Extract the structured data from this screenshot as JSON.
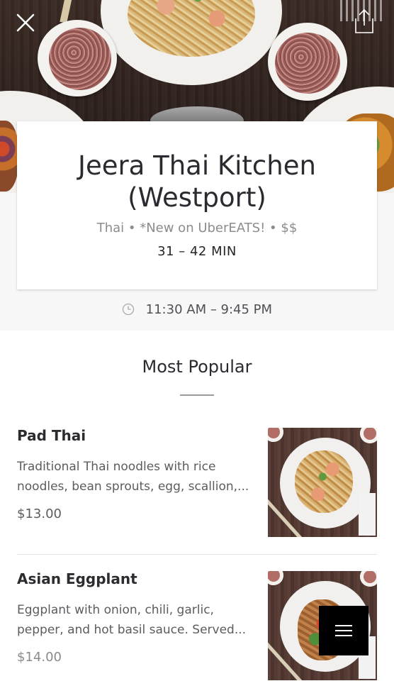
{
  "hero": {
    "close_icon": "close-icon",
    "share_icon": "share-icon"
  },
  "restaurant": {
    "name_line1": "Jeera Thai Kitchen",
    "name_line2": "(Westport)",
    "meta": "Thai • *New on UberEATS! • $$",
    "eta": "31 – 42 MIN",
    "hours": "11:30 AM – 9:45 PM",
    "hours_icon": "clock-icon"
  },
  "menu": {
    "section_title": "Most Popular",
    "items": [
      {
        "name": "Pad Thai",
        "desc_line1": "Traditional Thai noodles with rice",
        "desc_line2": "noodles, bean sprouts, egg, scallion,...",
        "price": "$13.00"
      },
      {
        "name": "Asian Eggplant",
        "desc_line1": "Eggplant with onion, chili, garlic,",
        "desc_line2": "pepper, and hot basil sauce. Served...",
        "price": "$14.00"
      }
    ]
  },
  "fab": {
    "icon": "hamburger-menu-icon"
  },
  "colors": {
    "card_bg": "#ffffff",
    "band_bg": "#f7f7f7",
    "text_primary": "#2a2a30",
    "text_secondary": "#8c8c8f",
    "fab_bg": "#000000"
  }
}
